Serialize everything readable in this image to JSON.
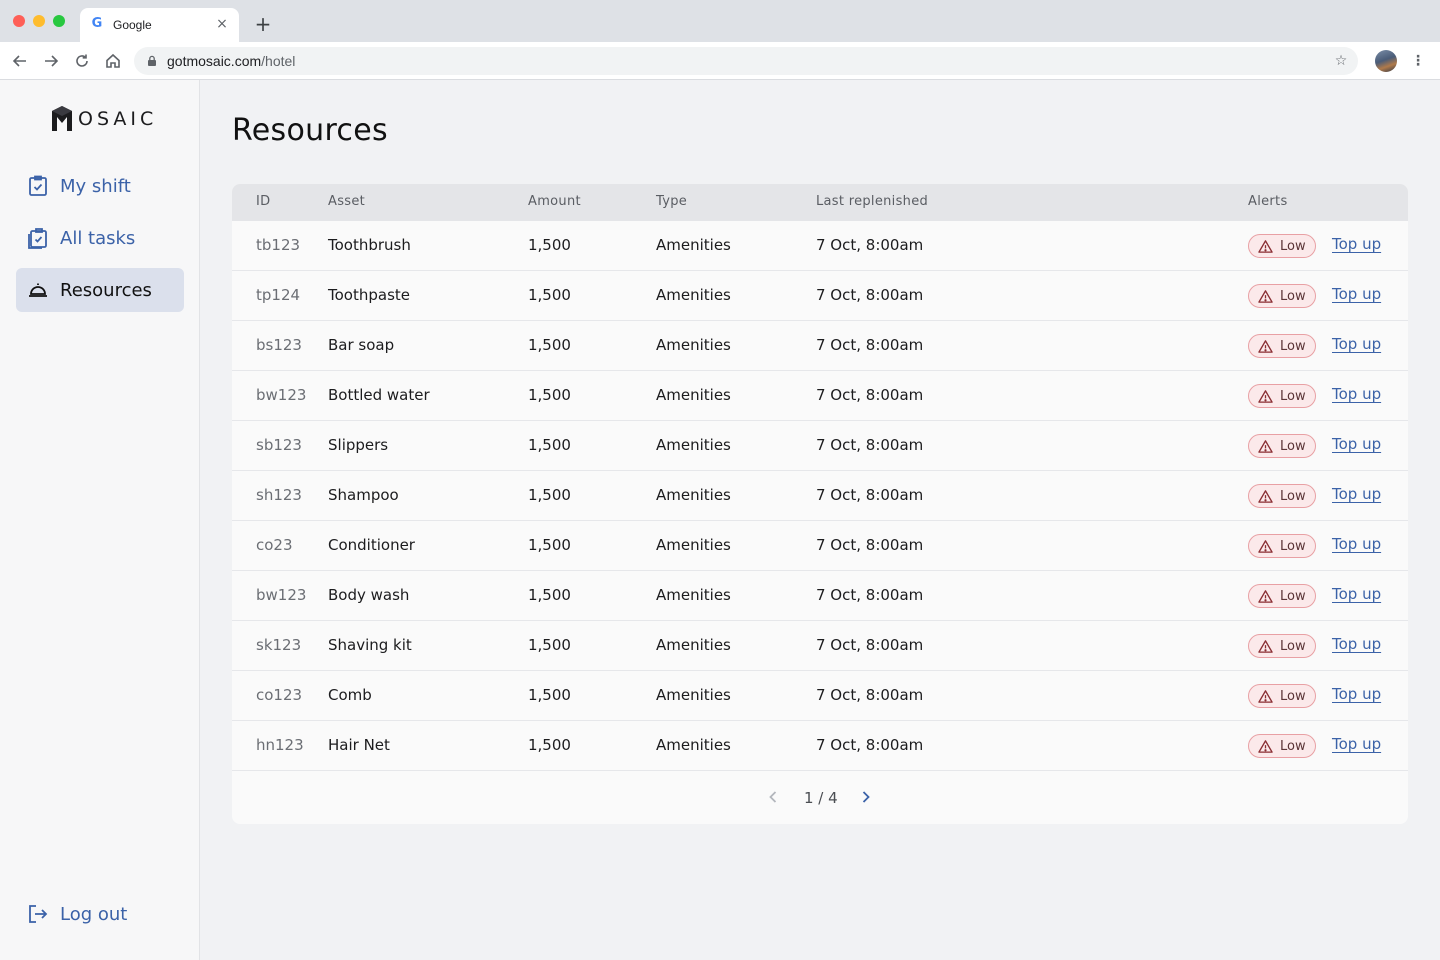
{
  "browser": {
    "tab_title": "Google",
    "tab_favicon": "G",
    "url_host": "gotmosaic.com",
    "url_path": "/hotel",
    "icons": [
      "back-icon",
      "forward-icon",
      "reload-icon",
      "home-icon",
      "lock-icon",
      "star-icon",
      "profile-avatar",
      "more-menu-icon"
    ]
  },
  "app": {
    "logo_text": "OSAIC",
    "accent": "#3b62a8"
  },
  "sidebar": {
    "items": [
      {
        "label": "My shift",
        "icon": "clipboard-check-icon"
      },
      {
        "label": "All tasks",
        "icon": "clipboard-list-icon"
      },
      {
        "label": "Resources",
        "icon": "service-bell-icon",
        "active": true
      }
    ],
    "logout": {
      "label": "Log out",
      "icon": "logout-icon"
    }
  },
  "main": {
    "title": "Resources",
    "columns": [
      "ID",
      "Asset",
      "Amount",
      "Type",
      "Last replenished",
      "Alerts"
    ],
    "rows": [
      {
        "id": "tb123",
        "asset": "Toothbrush",
        "amount": "1,500",
        "type": "Amenities",
        "last": "7 Oct, 8:00am",
        "alert": "Low",
        "action": "Top up"
      },
      {
        "id": "tp124",
        "asset": "Toothpaste",
        "amount": "1,500",
        "type": "Amenities",
        "last": "7 Oct, 8:00am",
        "alert": "Low",
        "action": "Top up"
      },
      {
        "id": "bs123",
        "asset": "Bar soap",
        "amount": "1,500",
        "type": "Amenities",
        "last": "7 Oct, 8:00am",
        "alert": "Low",
        "action": "Top up"
      },
      {
        "id": "bw123",
        "asset": "Bottled water",
        "amount": "1,500",
        "type": "Amenities",
        "last": "7 Oct, 8:00am",
        "alert": "Low",
        "action": "Top up"
      },
      {
        "id": "sb123",
        "asset": "Slippers",
        "amount": "1,500",
        "type": "Amenities",
        "last": "7 Oct, 8:00am",
        "alert": "Low",
        "action": "Top up"
      },
      {
        "id": "sh123",
        "asset": "Shampoo",
        "amount": "1,500",
        "type": "Amenities",
        "last": "7 Oct, 8:00am",
        "alert": "Low",
        "action": "Top up"
      },
      {
        "id": "co23",
        "asset": "Conditioner",
        "amount": "1,500",
        "type": "Amenities",
        "last": "7 Oct, 8:00am",
        "alert": "Low",
        "action": "Top up"
      },
      {
        "id": "bw123",
        "asset": "Body wash",
        "amount": "1,500",
        "type": "Amenities",
        "last": "7 Oct, 8:00am",
        "alert": "Low",
        "action": "Top up"
      },
      {
        "id": "sk123",
        "asset": "Shaving kit",
        "amount": "1,500",
        "type": "Amenities",
        "last": "7 Oct, 8:00am",
        "alert": "Low",
        "action": "Top up"
      },
      {
        "id": "co123",
        "asset": "Comb",
        "amount": "1,500",
        "type": "Amenities",
        "last": "7 Oct, 8:00am",
        "alert": "Low",
        "action": "Top up"
      },
      {
        "id": "hn123",
        "asset": "Hair Net",
        "amount": "1,500",
        "type": "Amenities",
        "last": "7 Oct, 8:00am",
        "alert": "Low",
        "action": "Top up"
      }
    ],
    "pagination": {
      "label": "1 / 4"
    }
  }
}
